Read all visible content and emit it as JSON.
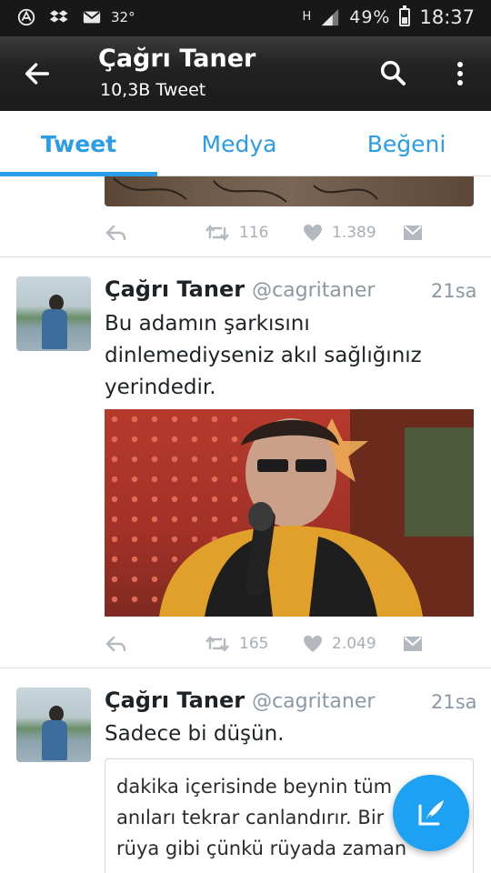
{
  "status_bar": {
    "temperature": "32°",
    "battery": "49%",
    "time": "18:37",
    "network": "H"
  },
  "header": {
    "title": "Çağrı Taner",
    "subtitle": "10,3B Tweet"
  },
  "tabs": [
    {
      "label": "Tweet",
      "active": true
    },
    {
      "label": "Medya",
      "active": false
    },
    {
      "label": "Beğeni",
      "active": false
    }
  ],
  "tweets": [
    {
      "retweets": "116",
      "likes": "1.389"
    },
    {
      "name": "Çağrı Taner",
      "handle": "@cagritaner",
      "time": "21sa",
      "text_lines": [
        "Bu adamın şarkısını",
        "dinlemediyseniz akıl sağlığınız",
        "yerindedir."
      ],
      "retweets": "165",
      "likes": "2.049"
    },
    {
      "name": "Çağrı Taner",
      "handle": "@cagritaner",
      "time": "21sa",
      "text": "Sadece bi düşün.",
      "quote_lines": [
        "dakika içerisinde beynin tüm",
        "anıları tekrar canlandırır. Bir",
        " rüya gibi çünkü rüyada zaman"
      ]
    }
  ],
  "colors": {
    "accent": "#2a9ce8",
    "fab": "#1da1f2"
  }
}
